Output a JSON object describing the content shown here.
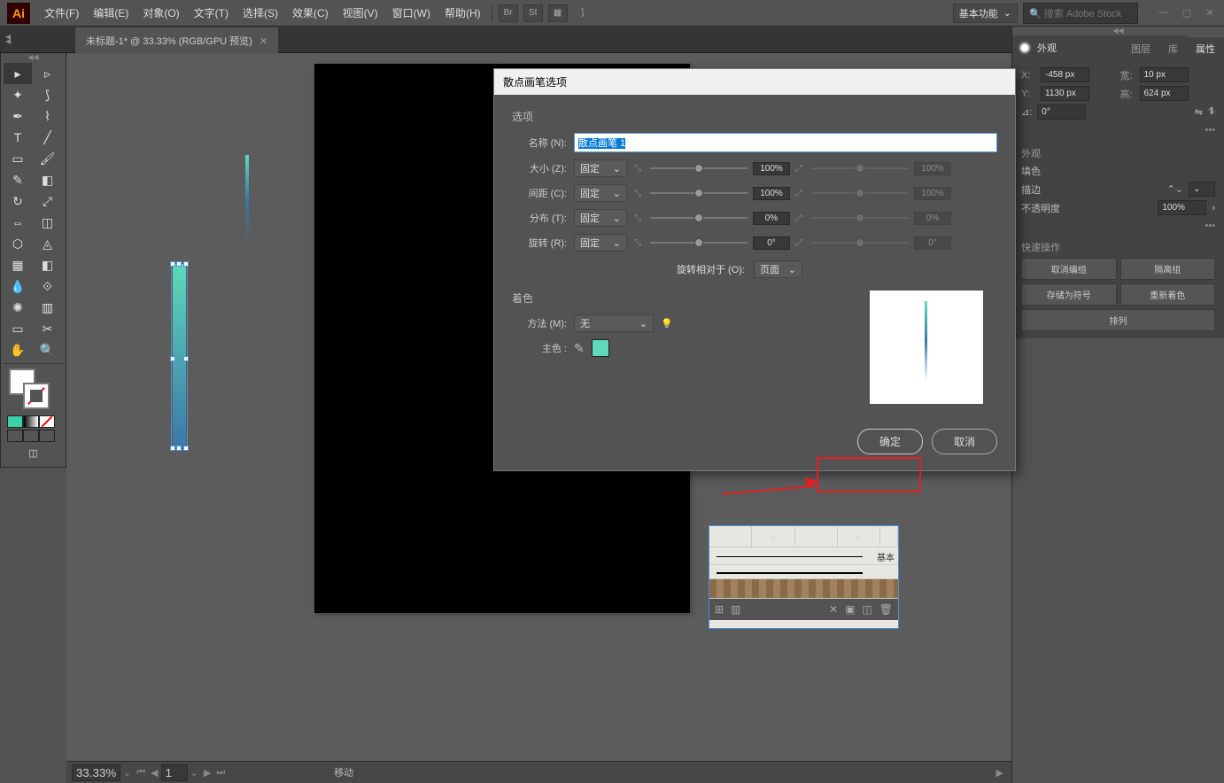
{
  "app": {
    "icon_label": "Ai"
  },
  "menubar": {
    "items": [
      "文件(F)",
      "编辑(E)",
      "对象(O)",
      "文字(T)",
      "选择(S)",
      "效果(C)",
      "视图(V)",
      "窗口(W)",
      "帮助(H)"
    ],
    "workspace": "基本功能",
    "search_placeholder": "搜索 Adobe Stock"
  },
  "tab": {
    "title": "未标题-1* @ 33.33% (RGB/GPU 预览)"
  },
  "statusbar": {
    "zoom": "33.33%",
    "page": "1",
    "tool_hint": "移动"
  },
  "panels": {
    "appearance": {
      "label": "外观",
      "tabs": [
        "图层",
        "库",
        "属性"
      ]
    },
    "props": {
      "transform": {
        "x": "-458 px",
        "y": "1130 px",
        "w": "10 px",
        "h": "624 px",
        "rotate": "0°"
      },
      "appearance": {
        "heading": "外观",
        "fill_label": "填色",
        "stroke_label": "描边",
        "opacity_label": "不透明度",
        "opacity_value": "100%"
      },
      "quick": {
        "heading": "快速操作",
        "ungroup": "取消编组",
        "isolate": "隔离组",
        "save_symbol": "存储为符号",
        "recolor": "重新着色",
        "arrange": "排列"
      }
    }
  },
  "brushes": {
    "basic_label": "基本"
  },
  "dialog": {
    "title": "散点画笔选项",
    "section_options": "选项",
    "name_label": "名称 (N):",
    "name_value": "散点画笔 1",
    "rows": [
      {
        "label": "大小 (Z):",
        "mode": "固定",
        "val1": "100%",
        "val2": "100%"
      },
      {
        "label": "间距 (C):",
        "mode": "固定",
        "val1": "100%",
        "val2": "100%"
      },
      {
        "label": "分布 (T):",
        "mode": "固定",
        "val1": "0%",
        "val2": "0%"
      },
      {
        "label": "旋转 (R):",
        "mode": "固定",
        "val1": "0°",
        "val2": "0°"
      }
    ],
    "rotate_relative_label": "旋转相对于 (O):",
    "rotate_relative_value": "页面",
    "section_color": "着色",
    "method_label": "方法 (M):",
    "method_value": "无",
    "key_color_label": "主色 :",
    "ok": "确定",
    "cancel": "取消"
  }
}
